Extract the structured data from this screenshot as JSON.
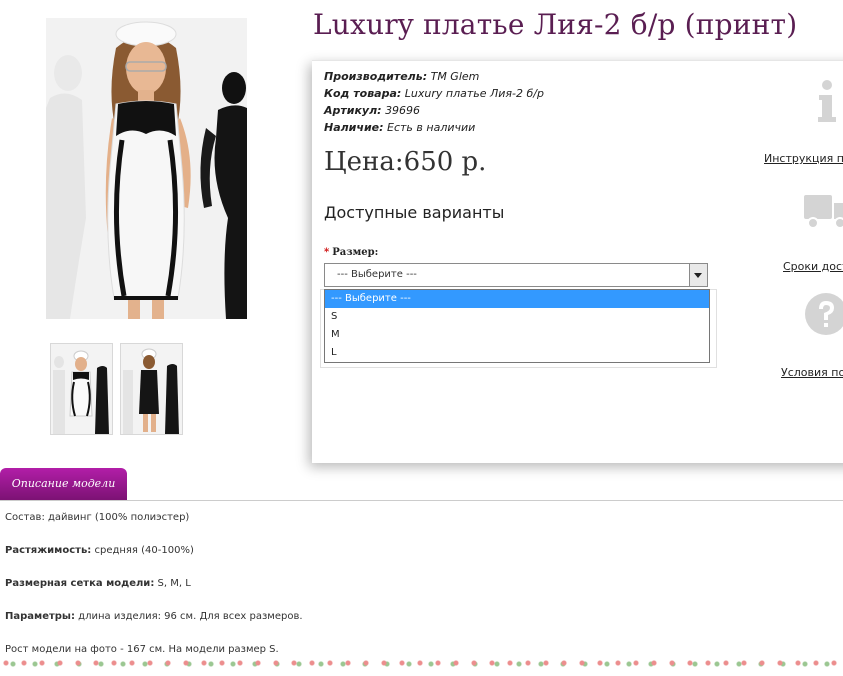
{
  "product": {
    "title": "Luxury платье Лия-2 б/р (принт)",
    "specs": [
      {
        "key": "Производитель:",
        "value": "ТМ Glem"
      },
      {
        "key": "Код товара:",
        "value": "Luxury платье Лия-2 б/р"
      },
      {
        "key": "Артикул:",
        "value": "39696"
      },
      {
        "key": "Наличие:",
        "value": "Есть в наличии"
      }
    ],
    "price": "Цена:650 р."
  },
  "options": {
    "heading": "Доступные варианты",
    "required_mark": "*",
    "size_label": "Размер:",
    "selected": "--- Выберите ---",
    "dropdown": [
      "--- Выберите ---",
      "S",
      "M",
      "L"
    ]
  },
  "side_links": {
    "instruction": "Инструкция по",
    "delivery": "Сроки дост",
    "conditions": "Условия пок"
  },
  "tabs": {
    "description": "Описание модели"
  },
  "description": [
    {
      "label": "",
      "text": "Состав: дайвинг (100% полиэстер)"
    },
    {
      "label": "Растяжимость:",
      "text": "средняя (40-100%)"
    },
    {
      "label": "Размерная сетка модели:",
      "text": "S, M, L"
    },
    {
      "label": "Параметры:",
      "text": "длина изделия: 96 см. Для всех размеров."
    },
    {
      "label": "",
      "text": "Рост модели на фото - 167 см. На модели размер S."
    }
  ],
  "colors": {
    "title": "#5a1e52",
    "tab": "#9c1a94",
    "highlight": "#3399ff"
  },
  "icons": [
    "info-icon",
    "truck-icon",
    "question-icon"
  ]
}
